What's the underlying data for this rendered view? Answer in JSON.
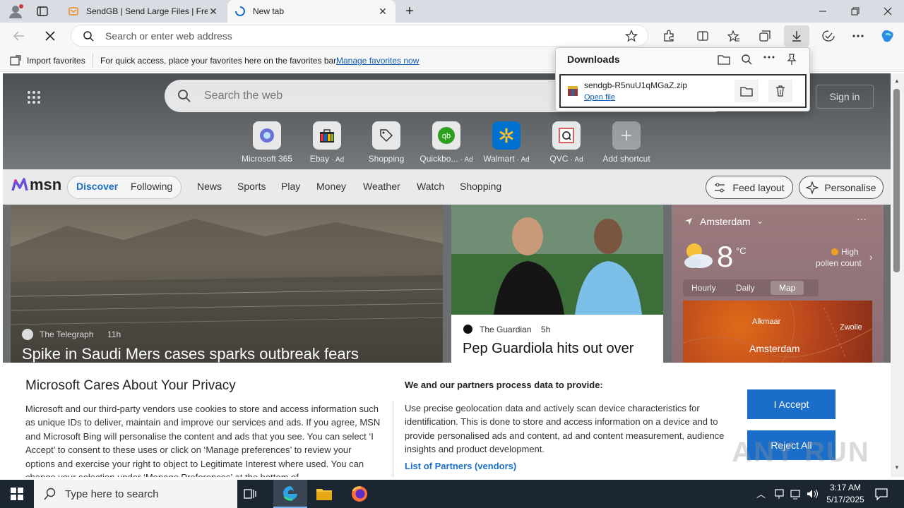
{
  "browser": {
    "tabs": [
      {
        "title": "SendGB | Send Large Files | Free f",
        "active": false
      },
      {
        "title": "New tab",
        "active": true
      }
    ],
    "address_placeholder": "Search or enter web address"
  },
  "favorites_bar": {
    "import_label": "Import favorites",
    "message": "For quick access, place your favorites here on the favorites bar.",
    "manage_link": "Manage favorites now"
  },
  "downloads": {
    "title": "Downloads",
    "file_name": "sendgb-R5nuU1qMGaZ.zip",
    "open_file": "Open file"
  },
  "ntp": {
    "search_placeholder": "Search the web",
    "sign_in": "Sign in",
    "shortcuts": [
      {
        "label": "Microsoft 365"
      },
      {
        "label": "Ebay",
        "ad": "· Ad"
      },
      {
        "label": "Shopping"
      },
      {
        "label": "Quickbo...",
        "ad": "· Ad"
      },
      {
        "label": "Walmart",
        "ad": "· Ad"
      },
      {
        "label": "QVC",
        "ad": "· Ad"
      },
      {
        "label": "Add shortcut"
      }
    ],
    "msn_logo": "msn",
    "nav": {
      "discover": "Discover",
      "following": "Following",
      "items": [
        "News",
        "Sports",
        "Play",
        "Money",
        "Weather",
        "Watch",
        "Shopping"
      ]
    },
    "feed_layout": "Feed layout",
    "personalise": "Personalise",
    "hero_card": {
      "source": "The Telegraph",
      "age": "11h",
      "headline": "Spike in Saudi Mers cases sparks outbreak fears"
    },
    "guardian_card": {
      "source": "The Guardian",
      "age": "5h",
      "headline": "Pep Guardiola hits out over"
    },
    "weather": {
      "location": "Amsterdam",
      "temp": "8",
      "unit": "°C",
      "pollen_line1": "High",
      "pollen_line2": "pollen count",
      "tabs": [
        "Hourly",
        "Daily",
        "Map"
      ],
      "map_labels": {
        "alkmaar": "Alkmaar",
        "zwolle": "Zwolle",
        "amsterdam": "Amsterdam"
      }
    }
  },
  "privacy": {
    "title": "Microsoft Cares About Your Privacy",
    "body": "Microsoft and our third-party vendors use cookies to store and access information such as unique IDs to deliver, maintain and improve our services and ads. If you agree, MSN and Microsoft Bing will personalise the content and ads that you see. You can select ‘I Accept’ to consent to these uses or click on ‘Manage preferences’ to review your options and exercise your right to object to Legitimate Interest where used.  You can change your selection under ‘Manage Preferences’ at the bottom of",
    "partners_heading": "We and our partners process data to provide:",
    "partners_body": "Use precise geolocation data and actively scan device characteristics for identification. This is done to store and access information on a device and to provide personalised ads and content, ad and content measurement, audience insights and product development.",
    "partners_link": "List of Partners (vendors)",
    "accept": "I Accept",
    "reject": "Reject All"
  },
  "watermark": "ANY RUN",
  "taskbar": {
    "search_placeholder": "Type here to search",
    "time": "3:17 AM",
    "date": "5/17/2025"
  },
  "colors": {
    "accent": "#1a6ec9",
    "taskbar": "#1c2633"
  }
}
